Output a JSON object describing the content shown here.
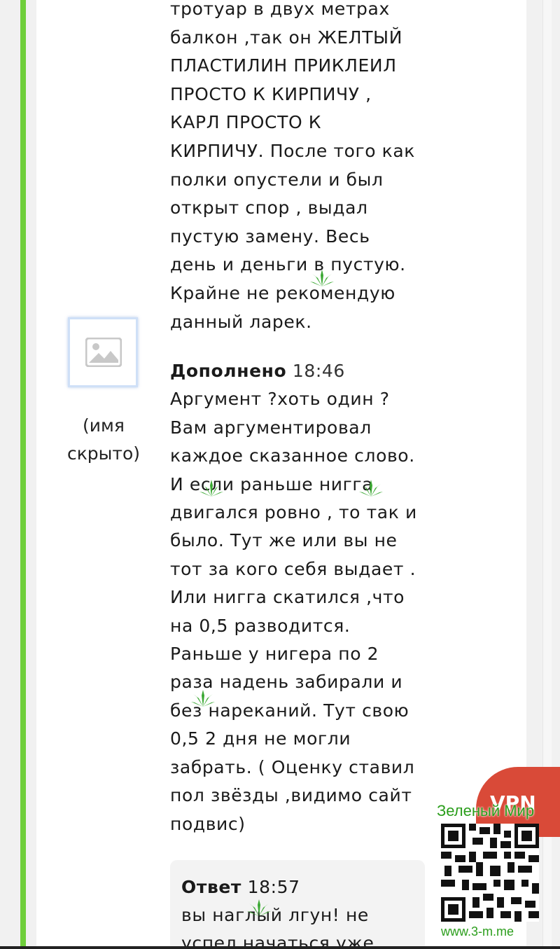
{
  "review": {
    "text": "тротуар в двух метрах\nбалкон ,так он ЖЕЛТЫЙ\nПЛАСТИЛИН ПРИКЛЕИЛ\nПРОСТО К КИРПИЧУ ,\nКАРЛ ПРОСТО К\nКИРПИЧУ. После того как\nполки опустели и был\nоткрыт спор , выдал\nпустую замену. Весь\nдень и деньги в пустую.\nКрайне не рекомендую\nданный ларек.",
    "author": "(имя скрыто)",
    "avatar_icon": "image-placeholder-icon"
  },
  "addendum": {
    "label": "Дополнено",
    "time": "18:46",
    "text": "Аргумент ?хоть один ?\nВам аргументировал\nкаждое сказанное слово.\nИ если раньше нигга\nдвигался ровно , то так и\nбыло. Тут же или вы не\nтот за кого себя выдает .\nИли нигга скатился ,что\nна 0,5 разводится.\nРаньше у нигера по 2\nраза надень забирали и\nбез нареканий. Тут свою\n0,5 2 дня не могли\nзабрать. ( Оценку ставил\nпол звёзды ,видимо сайт\nподвис)"
  },
  "reply": {
    "label": "Ответ",
    "time": "18:57",
    "text": "вы наглый лгун! не\nуспел начаться уже"
  },
  "watermark": {
    "title": "Зеленый Мир",
    "url": "www.3-m.me",
    "badge": "VPN"
  },
  "colors": {
    "accent_bar": "#6fcf3b",
    "watermark_green": "#2b9e1c",
    "vpn_badge": "#d94a38",
    "leaf": "#3aa832"
  }
}
